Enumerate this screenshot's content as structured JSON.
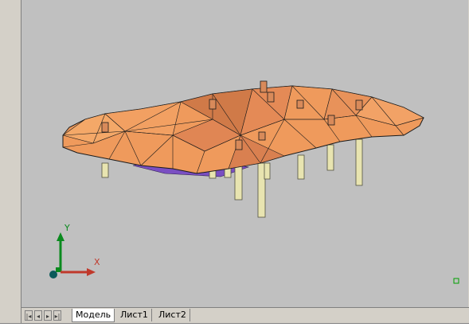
{
  "tabs": [
    {
      "label": "Модель",
      "active": true
    },
    {
      "label": "Лист1",
      "active": false
    },
    {
      "label": "Лист2",
      "active": false
    }
  ],
  "ucs": {
    "x_label": "X",
    "y_label": "Y"
  },
  "nav_buttons": [
    "first",
    "prev",
    "next",
    "last"
  ],
  "colors": {
    "background": "#c0c0c0",
    "surface_light": "#ef9a5c",
    "surface_dark": "#d07a48",
    "underside": "#7a4fc2",
    "pile": "#e8e4b0",
    "axis_y": "#0a8a1e",
    "axis_x": "#c0392b"
  }
}
